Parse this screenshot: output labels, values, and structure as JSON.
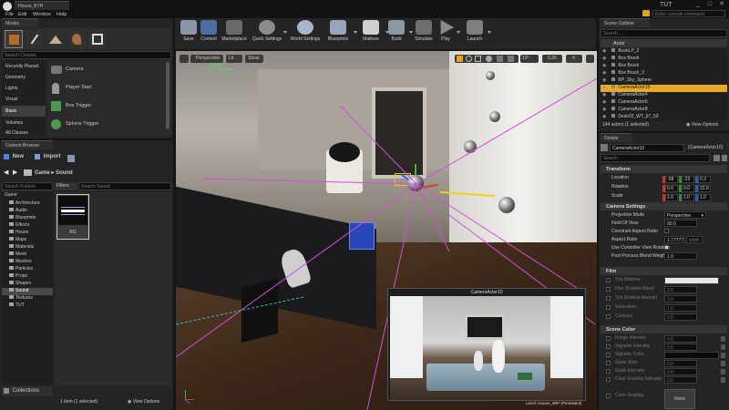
{
  "window": {
    "title": "House_BTH",
    "branding": "TUT",
    "console_placeholder": "Enter console command"
  },
  "menu": [
    "File",
    "Edit",
    "Window",
    "Help"
  ],
  "modes": {
    "tab": "Modes",
    "search_placeholder": "Search Classes",
    "categories": [
      "Recently Placed",
      "Geometry",
      "Lights",
      "Visual",
      "Basic",
      "Volumes",
      "All Classes"
    ],
    "selected_category": "Basic",
    "items": [
      "Camera",
      "Player Start",
      "Box Trigger",
      "Sphere Trigger"
    ]
  },
  "toolbar": [
    "Save",
    "Content",
    "Marketplace",
    "Quick Settings",
    "World Settings",
    "Blueprints",
    "Matinee",
    "Build",
    "Simulate",
    "Play",
    "Launch"
  ],
  "viewport": {
    "view_mode": "Perspective",
    "lighting": "Lit",
    "show": "Show",
    "stats_a": "118.66",
    "stats_b": "57 / 158 mm",
    "snap_angle": "10°",
    "snap_scale": "0.25",
    "camera_speed": "4",
    "pip_title": "CameraActor10",
    "level_label": "Level:  House_WIP (Persistent)"
  },
  "content_browser": {
    "tab": "Content Browser",
    "new_label": "New",
    "import_label": "Import",
    "path": [
      "Game",
      "Sound"
    ],
    "folder_search_placeholder": "Search Folders",
    "filters_label": "Filters",
    "asset_search_placeholder": "Search Sound",
    "root": "Game",
    "folders": [
      "Architecture",
      "Audio",
      "Blueprints",
      "Effects",
      "House",
      "Maps",
      "Materials",
      "Mesh",
      "Meshes",
      "Particles",
      "Props",
      "Shapes",
      "Sound",
      "Textures",
      "TUT"
    ],
    "selected_folder": "Sound",
    "asset_name": "BG",
    "collections_label": "Collections",
    "status": "1 item (1 selected)",
    "view_options": "View Options"
  },
  "outliner": {
    "tab": "Scene Outliner",
    "search_placeholder": "Search...",
    "column": "Actor",
    "items": [
      "BookLP_2",
      "Box Brush",
      "Box Brush",
      "Box Brush_2",
      "BP_Sky_Sphere",
      "CameraActor10",
      "CameraActor4",
      "CameraActor6",
      "CameraActor8",
      "Desk03_WT_67_52"
    ],
    "selected": "CameraActor10",
    "count": "144 actors (1 selected)",
    "view_options": "View Options"
  },
  "details": {
    "tab": "Details",
    "name": "CameraActor10",
    "name_suffix": "(CameraActor10)",
    "search_placeholder": "Search",
    "transform_header": "Transform",
    "location_label": "Location",
    "rotation_label": "Rotation",
    "scale_label": "Scale",
    "location": [
      "-98",
      "-23",
      "0.3"
    ],
    "rotation": [
      "0.0",
      "0.0",
      "22.8"
    ],
    "scale": [
      "1.0",
      "1.0",
      "1.0"
    ],
    "camera_header": "Camera Settings",
    "projection_label": "Projection Mode",
    "projection_value": "Perspective",
    "fov_label": "Field Of View",
    "fov_value": "90.0",
    "constrain_label": "Constrain Aspect Ratio",
    "aspect_label": "Aspect Ratio",
    "aspect_value": "1.777778",
    "aspect_extra": "width",
    "use_controller_label": "Use Controller View Rotation",
    "post_process_label": "Post Process Blend Weight",
    "post_process_value": "1.0",
    "film_header": "Film",
    "film_rows": [
      "Tint Shadow",
      "Film Shadow Blend",
      "Tint Shadow Amount",
      "Saturation",
      "Contrast"
    ],
    "film_values": [
      "",
      "0.5",
      "1.0",
      "1.0",
      "0.0"
    ],
    "scene_header": "Scene Color",
    "scene_rows": [
      "Fringe Intensity",
      "Vignette Intensity",
      "Vignette Color",
      "Grain Jitter",
      "Grain Intensity",
      "Color Grading Intensity",
      "",
      "Color Grading"
    ],
    "scene_values": [
      "0.0",
      "0.0",
      "",
      "0.0",
      "0.0",
      "0.0",
      "",
      ""
    ],
    "none_button": "None"
  }
}
